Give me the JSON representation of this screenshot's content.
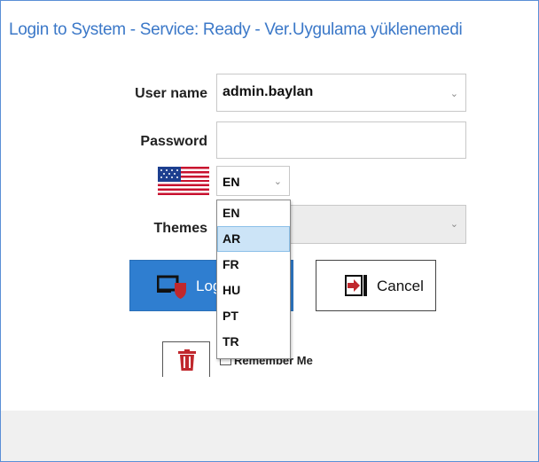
{
  "window": {
    "title": "Login to System - Service: Ready - Ver.Uygulama yüklenemedi"
  },
  "form": {
    "username_label": "User name",
    "username_value": "admin.baylan",
    "password_label": "Password",
    "password_value": "",
    "language_value": "EN",
    "themes_label": "Themes",
    "themes_value": ""
  },
  "language_dropdown": {
    "options": [
      "EN",
      "AR",
      "FR",
      "HU",
      "PT",
      "TR"
    ],
    "highlighted": "AR"
  },
  "buttons": {
    "login_label": "Login",
    "cancel_label": "Cancel"
  },
  "remember": {
    "label": "Remember Me",
    "checked": false
  },
  "icons": {
    "flag": "us-flag-icon",
    "login": "login-shield-icon",
    "cancel": "exit-arrow-icon",
    "delete": "trash-icon"
  },
  "colors": {
    "accent": "#2f7ed0",
    "title": "#3b78c8",
    "selection": "#cce4f7",
    "icon_red": "#c0282d"
  }
}
